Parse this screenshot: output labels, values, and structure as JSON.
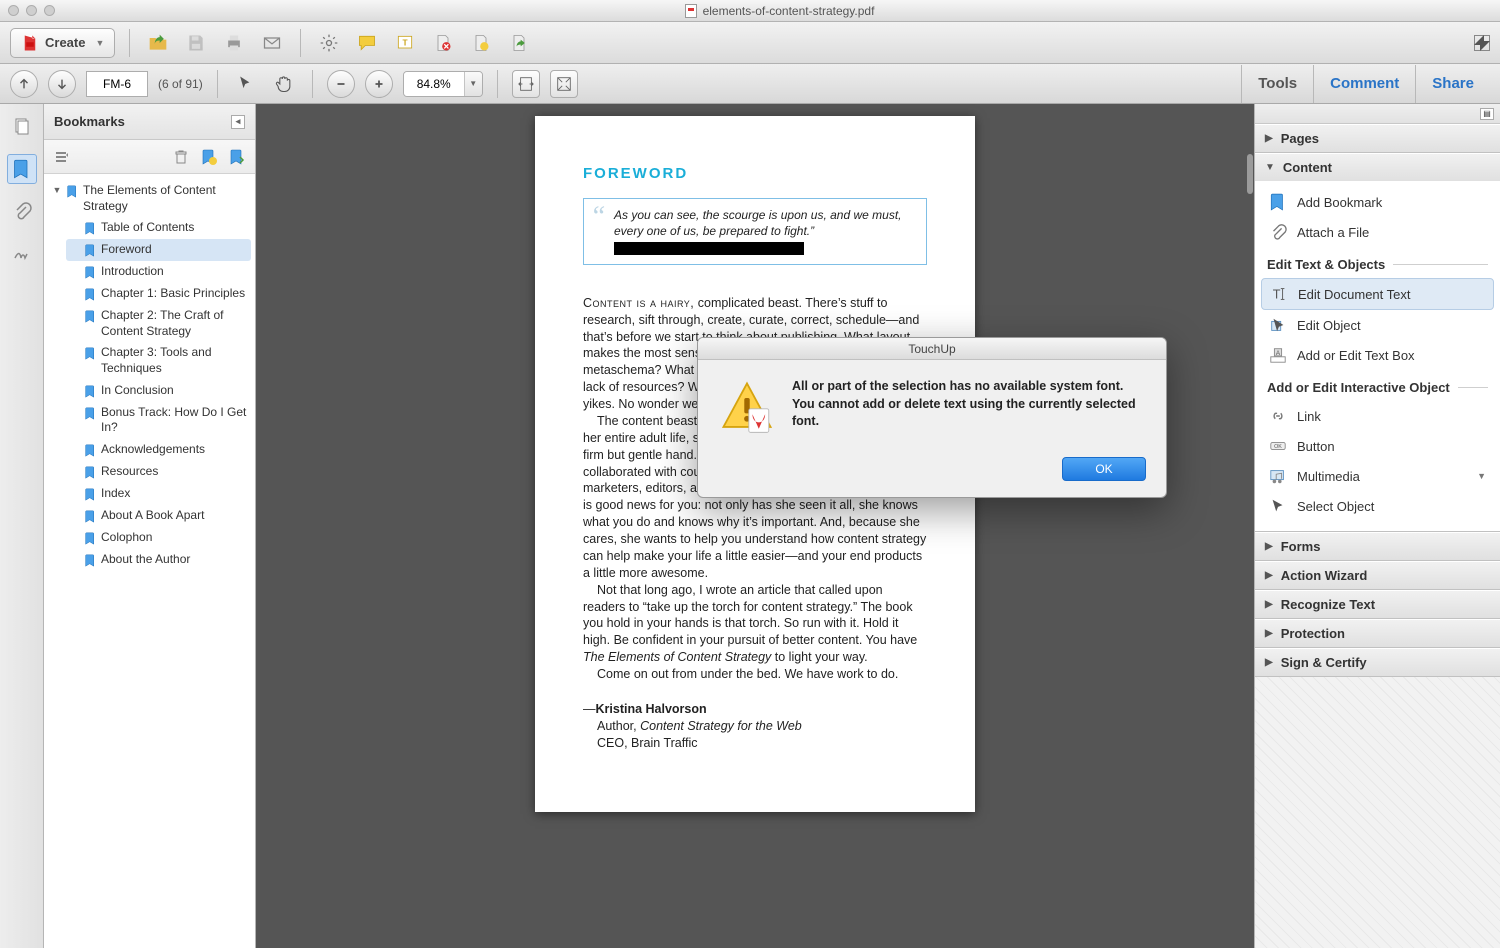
{
  "window": {
    "title": "elements-of-content-strategy.pdf"
  },
  "toolbar": {
    "create_label": "Create"
  },
  "nav": {
    "page_field": "FM-6",
    "page_count": "(6 of 91)",
    "zoom": "84.8%",
    "tools": "Tools",
    "comment": "Comment",
    "share": "Share"
  },
  "bookmarks": {
    "title": "Bookmarks",
    "root": "The Elements of Content Strategy",
    "items": [
      "Table of Contents",
      "Foreword",
      "Introduction",
      "Chapter 1: Basic Principles",
      "Chapter 2: The Craft of Content Strategy",
      "Chapter 3: Tools and Techniques",
      "In Conclusion",
      "Bonus Track: How Do I Get In?",
      "Acknowledgements",
      "Resources",
      "Index",
      "About A Book Apart",
      "Colophon",
      "About the Author"
    ],
    "selected_index": 1
  },
  "document": {
    "heading": "FOREWORD",
    "quote": "As you can see, the scourge is upon us, and we must, every one of us, be prepared to fight.”",
    "p1a": "Content is a hairy,",
    "p1b": " complicated beast. There’s stuff to research, sift through, create, curate, correct, schedule—and that’s before we start to think about publishing. What layout makes the most sense for this content? What platform? What metaschema? What about the content creators, their plans, or lack of resources? What about translation? What about… or…yikes. No wonder we hide under the bed.",
    "p2": "The content beast doesn’t scare Erin Kissane. She’s spent her entire adult life, she’s learned to tame the beast with a firm but gentle hand. As part of that journey, she’s worked and collaborated with countless information architects, designers, marketers, editors, and writers to get the job done. Now there is good news for you: not only has she seen it all, she knows what you do and knows why it’s important. And, because she cares, she wants to help you understand how content strategy can help make your life a little easier—and your end products a little more awesome.",
    "p3a": "Not that long ago, I wrote an article that called upon readers to “take up the torch for content strategy.” The book you hold in your hands is that torch. So run with it. Hold it high. Be confident in your pursuit of better content. You have ",
    "p3b": "The Elements of Content Strategy",
    "p3c": " to light your way.",
    "p4": "Come on out from under the bed. We have work to do.",
    "author_name": "Kristina Halvorson",
    "author_line2a": "Author, ",
    "author_line2b": "Content Strategy for the Web",
    "author_line3": "CEO, Brain Traffic"
  },
  "rightpanel": {
    "sections": {
      "pages": "Pages",
      "content": "Content",
      "forms": "Forms",
      "action_wizard": "Action Wizard",
      "recognize_text": "Recognize Text",
      "protection": "Protection",
      "sign_certify": "Sign & Certify"
    },
    "content_items": {
      "add_bookmark": "Add Bookmark",
      "attach_file": "Attach a File",
      "sub1": "Edit Text & Objects",
      "edit_document_text": "Edit Document Text",
      "edit_object": "Edit Object",
      "add_text_box": "Add or Edit Text Box",
      "sub2": "Add or Edit Interactive Object",
      "link": "Link",
      "button": "Button",
      "multimedia": "Multimedia",
      "select_object": "Select Object"
    }
  },
  "dialog": {
    "title": "TouchUp",
    "message": "All or part of the selection has no available system font. You cannot add or delete text using the currently selected font.",
    "ok": "OK"
  }
}
